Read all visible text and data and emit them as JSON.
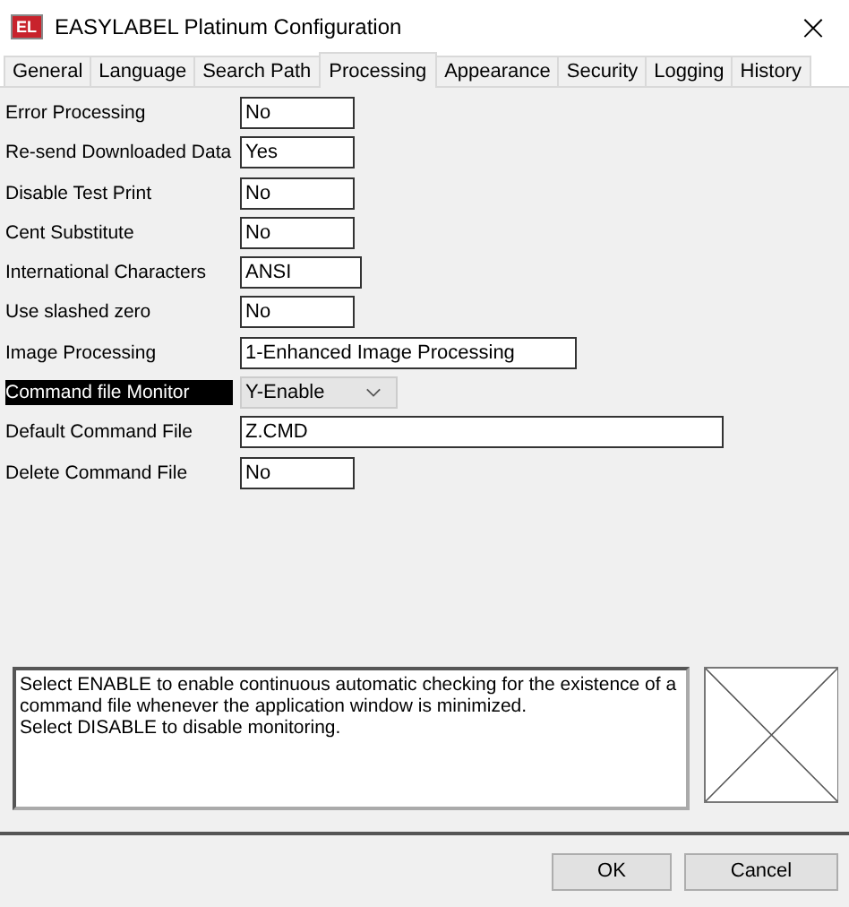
{
  "window": {
    "title": "EASYLABEL Platinum Configuration",
    "logo": "EL",
    "close": "×"
  },
  "tabs": [
    {
      "label": "General",
      "selected": false
    },
    {
      "label": "Language",
      "selected": false
    },
    {
      "label": "Search Path",
      "selected": false
    },
    {
      "label": "Processing",
      "selected": true
    },
    {
      "label": "Appearance",
      "selected": false
    },
    {
      "label": "Security",
      "selected": false
    },
    {
      "label": "Logging",
      "selected": false
    },
    {
      "label": "History",
      "selected": false
    }
  ],
  "settings": [
    {
      "label": "Error Processing",
      "value": "No",
      "kind": "short",
      "selected": false
    },
    {
      "label": "Re-send Downloaded Data",
      "value": "Yes",
      "kind": "short",
      "selected": false
    },
    {
      "label": "Disable Test Print",
      "value": "No",
      "kind": "short",
      "selected": false
    },
    {
      "label": "Cent Substitute",
      "value": "No",
      "kind": "short",
      "selected": false
    },
    {
      "label": "International Characters",
      "value": "ANSI",
      "kind": "medium",
      "selected": false
    },
    {
      "label": "Use slashed zero",
      "value": "No",
      "kind": "short",
      "selected": false
    },
    {
      "label": "Image Processing",
      "value": "1-Enhanced Image Processing",
      "kind": "long",
      "selected": false
    },
    {
      "label": "Command file Monitor",
      "value": "Y-Enable",
      "kind": "combo",
      "selected": true
    },
    {
      "label": "Default Command File",
      "value": "Z.CMD",
      "kind": "wide",
      "selected": false
    },
    {
      "label": "Delete Command File",
      "value": "No",
      "kind": "short",
      "selected": false
    }
  ],
  "description": [
    "Select ENABLE to enable continuous automatic checking for the existence of a command file whenever the application window is minimized.",
    "Select DISABLE to disable monitoring."
  ],
  "buttons": [
    "OK",
    "Cancel"
  ]
}
